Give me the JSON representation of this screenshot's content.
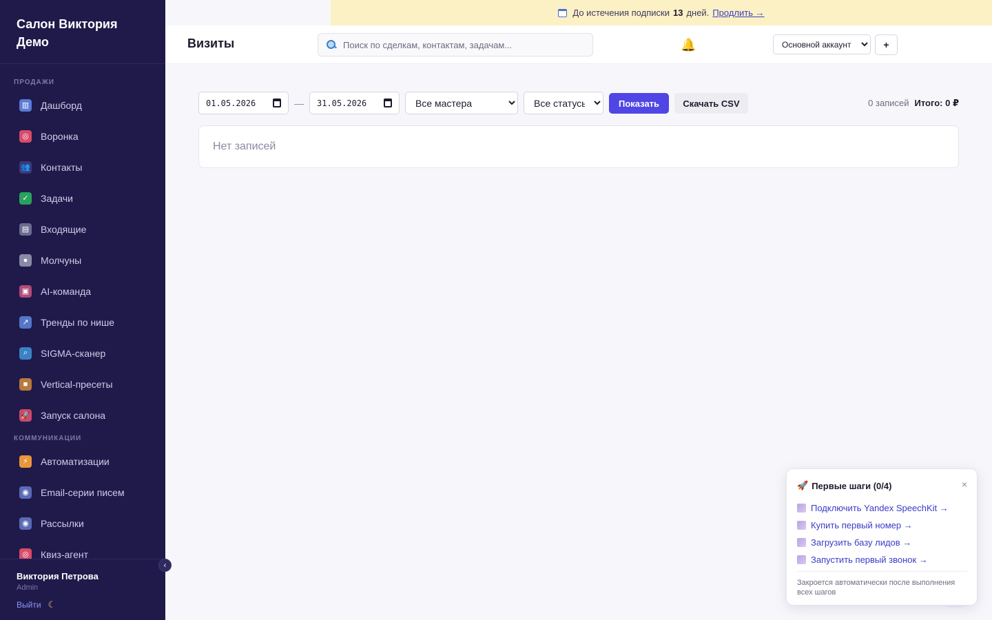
{
  "sidebar": {
    "brand_line1": "Салон Виктория",
    "brand_line2": "Демо",
    "section_sales": "ПРОДАЖИ",
    "section_comms": "КОММУНИКАЦИИ",
    "items": [
      {
        "label": "Дашборд",
        "icon": "chart-icon",
        "color": "#5a7bd6",
        "glyph": "▥"
      },
      {
        "label": "Воронка",
        "icon": "target-icon",
        "color": "#d94a6a",
        "glyph": "◎"
      },
      {
        "label": "Контакты",
        "icon": "people-icon",
        "color": "#3d3877",
        "glyph": "👥"
      },
      {
        "label": "Задачи",
        "icon": "checkbox-icon",
        "color": "#27a35c",
        "glyph": "✓"
      },
      {
        "label": "Входящие",
        "icon": "inbox-icon",
        "color": "#6b6b8f",
        "glyph": "▤"
      },
      {
        "label": "Молчуны",
        "icon": "speech-bubble-icon",
        "color": "#8a8aa8",
        "glyph": "●"
      },
      {
        "label": "AI-команда",
        "icon": "robot-icon",
        "color": "#b14c7a",
        "glyph": "▣"
      },
      {
        "label": "Тренды по нише",
        "icon": "trend-icon",
        "color": "#5576c7",
        "glyph": "↗"
      },
      {
        "label": "SIGMA-сканер",
        "icon": "magnifier-icon",
        "color": "#3b82c4",
        "glyph": "⌕"
      },
      {
        "label": "Vertical-пресеты",
        "icon": "package-icon",
        "color": "#b87a3c",
        "glyph": "■"
      },
      {
        "label": "Запуск салона",
        "icon": "rocket-icon",
        "color": "#c84b6e",
        "glyph": "🚀"
      }
    ],
    "comm_items": [
      {
        "label": "Автоматизации",
        "icon": "lightning-icon",
        "color": "#e8963a",
        "glyph": "⚡"
      },
      {
        "label": "Email-серии писем",
        "icon": "email-icon",
        "color": "#5a6bb6",
        "glyph": "◉"
      },
      {
        "label": "Рассылки",
        "icon": "broadcast-icon",
        "color": "#5a6bb6",
        "glyph": "◉"
      },
      {
        "label": "Квиз-агент",
        "icon": "target-icon",
        "color": "#d94a6a",
        "glyph": "◎"
      }
    ],
    "user_name": "Виктория Петрова",
    "user_role": "Admin",
    "logout": "Выйти",
    "collapse": "‹"
  },
  "banner": {
    "prefix": "До истечения подписки",
    "days": "13",
    "suffix": "дней.",
    "link": "Продлить →"
  },
  "header": {
    "title": "Визиты",
    "search_placeholder": "Поиск по сделкам, контактам, задачам...",
    "account": "Основной аккаунт",
    "plus": "+"
  },
  "filters": {
    "date_from": "01.05.2026",
    "date_to": "31.05.2026",
    "dash": "—",
    "masters": "Все мастера",
    "statuses": "Все статусы",
    "show": "Показать",
    "download": "Скачать CSV",
    "count": "0 записей",
    "total": "Итого: 0 ₽"
  },
  "empty": "Нет записей",
  "onboarding": {
    "title": "Первые шаги (0/4)",
    "steps": [
      "Подключить Yandex SpeechKit →",
      "Купить первый номер →",
      "Загрузить базу лидов →",
      "Запустить первый звонок →"
    ],
    "note": "Закроется автоматически после выполнения всех шагов",
    "close": "×"
  }
}
